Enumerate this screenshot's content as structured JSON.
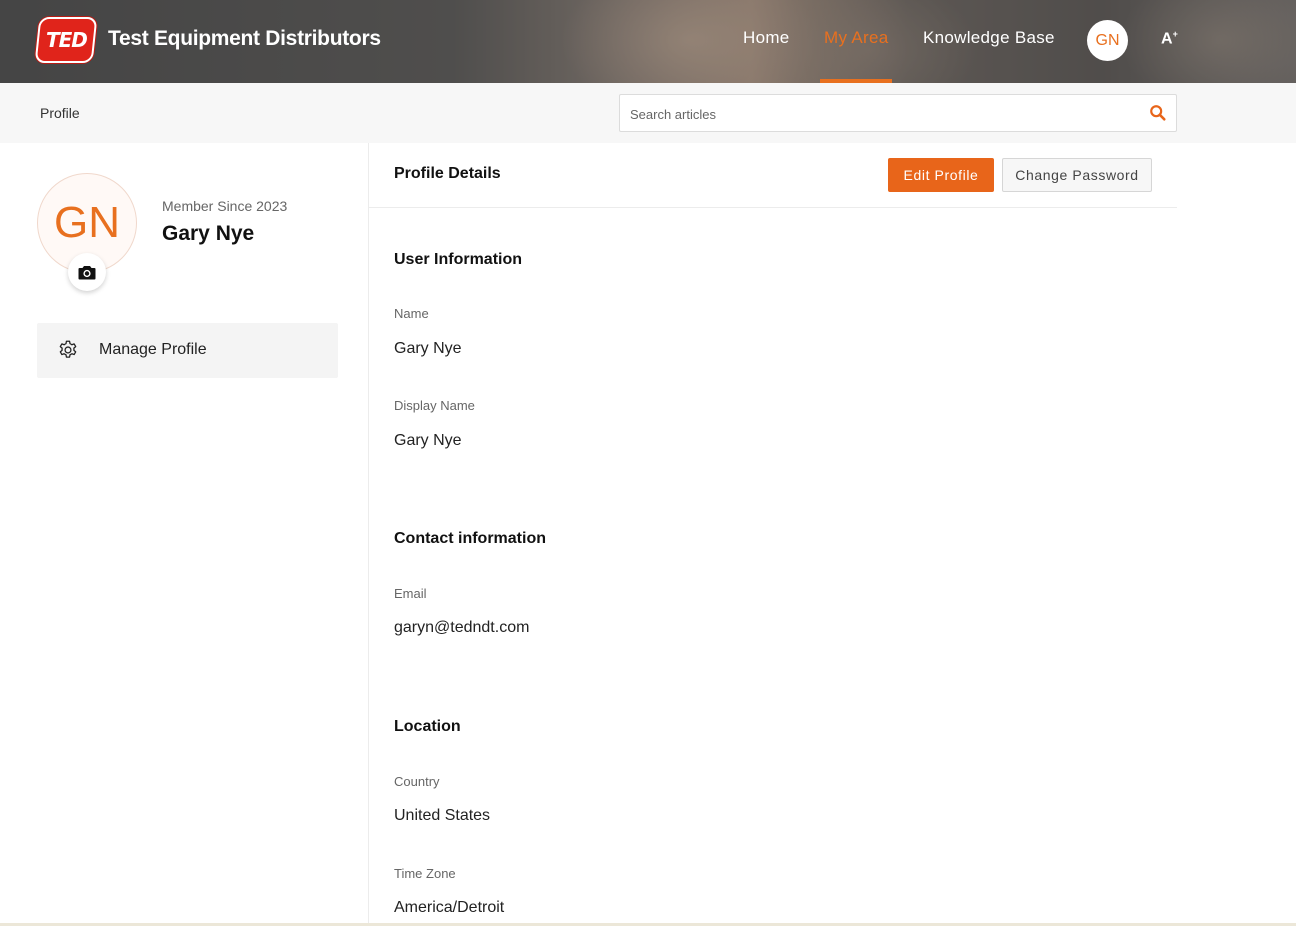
{
  "header": {
    "logo_text": "TED",
    "brand": "Test Equipment Distributors",
    "nav": [
      {
        "label": "Home"
      },
      {
        "label": "My Area",
        "active": true
      },
      {
        "label": "Knowledge Base"
      }
    ],
    "user_initials": "GN",
    "accessibility_label": "A",
    "accent_color": "#e8701f"
  },
  "subbar": {
    "breadcrumb": "Profile",
    "search": {
      "placeholder": "Search articles",
      "value": "",
      "icon": "search-icon"
    }
  },
  "sidebar": {
    "avatar_initials": "GN",
    "camera_icon": "camera-icon",
    "member_since": "Member Since 2023",
    "name": "Gary Nye",
    "menu": [
      {
        "label": "Manage Profile",
        "icon": "gear-icon"
      }
    ]
  },
  "main": {
    "title": "Profile Details",
    "edit_button": "Edit Profile",
    "change_password_button": "Change Password",
    "sections": [
      {
        "title": "User Information",
        "fields": [
          {
            "label": "Name",
            "value": "Gary Nye"
          },
          {
            "label": "Display Name",
            "value": "Gary Nye"
          }
        ]
      },
      {
        "title": "Contact information",
        "fields": [
          {
            "label": "Email",
            "value": "garyn@tedndt.com"
          }
        ]
      },
      {
        "title": "Location",
        "fields": [
          {
            "label": "Country",
            "value": "United States"
          },
          {
            "label": "Time Zone",
            "value": "America/Detroit"
          }
        ]
      }
    ]
  }
}
